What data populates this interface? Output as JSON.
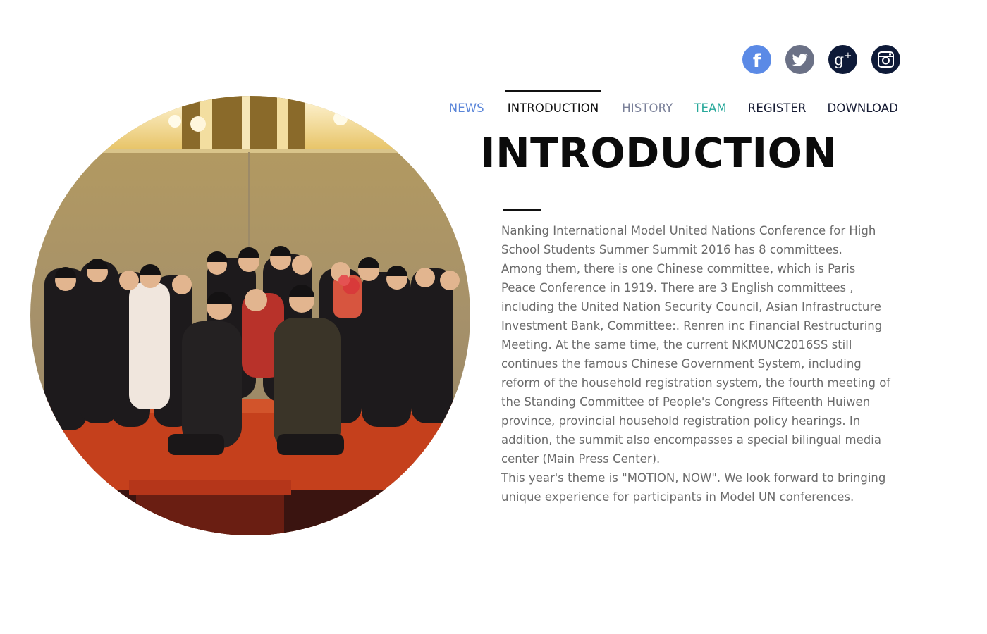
{
  "social": {
    "facebook_glyph": "f",
    "icons": [
      "facebook-icon",
      "twitter-icon",
      "google-plus-icon",
      "instagram-icon"
    ],
    "colors": {
      "facebook": "#5b8ae6",
      "twitter": "#6b7186",
      "google_plus": "#0e1a38",
      "instagram": "#0e1a38"
    }
  },
  "nav": {
    "items": [
      {
        "label": "NEWS",
        "color": "#5b86d9"
      },
      {
        "label": "INTRODUCTION",
        "color": "#111111",
        "active": true
      },
      {
        "label": "HISTORY",
        "color": "#7a8099"
      },
      {
        "label": "TEAM",
        "color": "#27a89a"
      },
      {
        "label": "REGISTER",
        "color": "#161b33"
      },
      {
        "label": "DOWNLOAD",
        "color": "#161b33"
      }
    ]
  },
  "page": {
    "heading": "INTRODUCTION",
    "paragraphs": [
      "Nanking International Model United Nations Conference for High School Students Summer Summit 2016 has 8 committees.",
      "Among them, there is one Chinese committee, which is Paris Peace Conference in 1919. There are 3 English committees , including the United Nation Security Council, Asian Infrastructure Investment Bank, Committee:. Renren inc Financial Restructuring Meeting. At the same time, the current NKMUNC2016SS still continues the famous Chinese Government System, including reform of the household registration system, the fourth meeting of the Standing Committee of People's Congress Fifteenth Huiwen province, provincial household registration policy hearings. In addition, the summit also encompasses a special bilingual media center (Main Press Center).",
      "This year's theme is \"MOTION, NOW\". We look forward to bringing unique experience for participants in Model UN conferences."
    ]
  }
}
